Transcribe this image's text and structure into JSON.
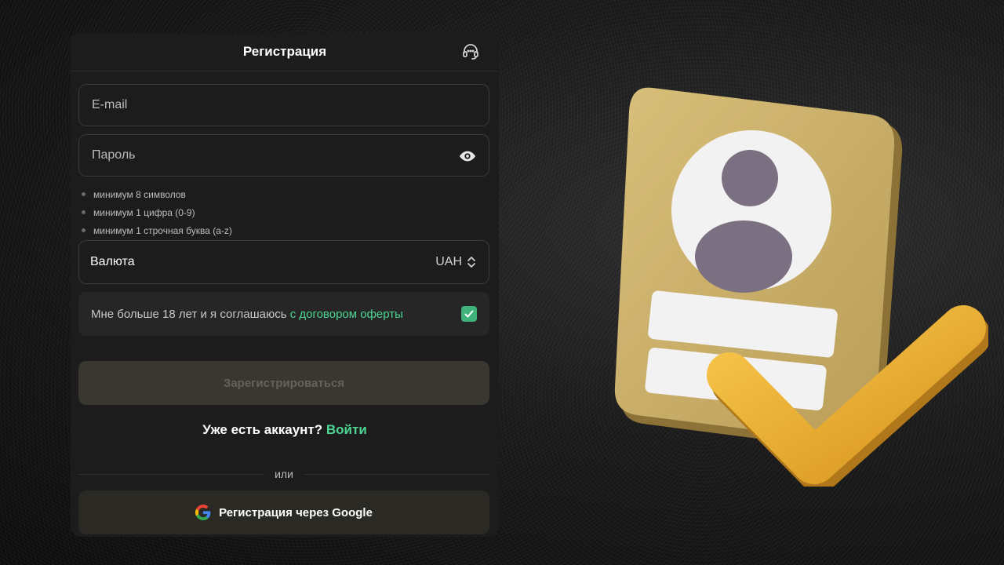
{
  "form": {
    "title": "Регистрация",
    "email_placeholder": "E-mail",
    "password_placeholder": "Пароль",
    "password_hints": [
      "минимум 8 символов",
      "минимум 1 цифра (0-9)",
      "минимум 1 строчная буква (a-z)"
    ],
    "currency_label": "Валюта",
    "currency_value": "UAH",
    "agreement_text": "Мне больше 18 лет и я соглашаюсь ",
    "agreement_link": "с договором оферты",
    "agreement_checked": true,
    "register_button": "Зарегистрироваться",
    "have_account_text": "Уже есть аккаунт?",
    "login_link": "Войти",
    "or_text": "или",
    "google_button": "Регистрация через Google"
  },
  "icons": {
    "support": "headset-icon",
    "password_toggle": "eye-icon",
    "currency_select": "chevron-up-down-icon",
    "checkbox": "checkmark-icon",
    "google": "google-logo-icon"
  },
  "colors": {
    "accent_green": "#4dd693",
    "checkbox_green": "#3fb37a",
    "panel_bg": "#1c1c1c",
    "register_button_bg": "#3a3730",
    "google_button_bg": "#2b2923",
    "illustration_card": "#cfb46e",
    "illustration_check": "#f0b73a",
    "illustration_avatar": "#7b6f82"
  }
}
